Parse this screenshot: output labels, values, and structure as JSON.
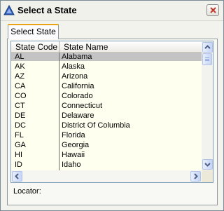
{
  "window": {
    "title": "Select a State",
    "app_icon": "blue-triangle-icon",
    "close_icon": "close-icon"
  },
  "tabs": [
    {
      "label": "Select State",
      "selected": true
    }
  ],
  "list": {
    "columns": [
      "State Code",
      "State Name"
    ],
    "selected_index": 0,
    "rows": [
      {
        "code": "AL",
        "name": "Alabama"
      },
      {
        "code": "AK",
        "name": "Alaska"
      },
      {
        "code": "AZ",
        "name": "Arizona"
      },
      {
        "code": "CA",
        "name": "California"
      },
      {
        "code": "CO",
        "name": "Colorado"
      },
      {
        "code": "CT",
        "name": "Connecticut"
      },
      {
        "code": "DE",
        "name": "Delaware"
      },
      {
        "code": "DC",
        "name": "District Of Columbia"
      },
      {
        "code": "FL",
        "name": "Florida"
      },
      {
        "code": "GA",
        "name": "Georgia"
      },
      {
        "code": "HI",
        "name": "Hawaii"
      },
      {
        "code": "ID",
        "name": "Idaho"
      }
    ]
  },
  "locator": {
    "label": "Locator:"
  },
  "colors": {
    "row_background": "#fffff0",
    "selected_row": "#c3c3c3",
    "tab_accent": "#e8a317"
  }
}
